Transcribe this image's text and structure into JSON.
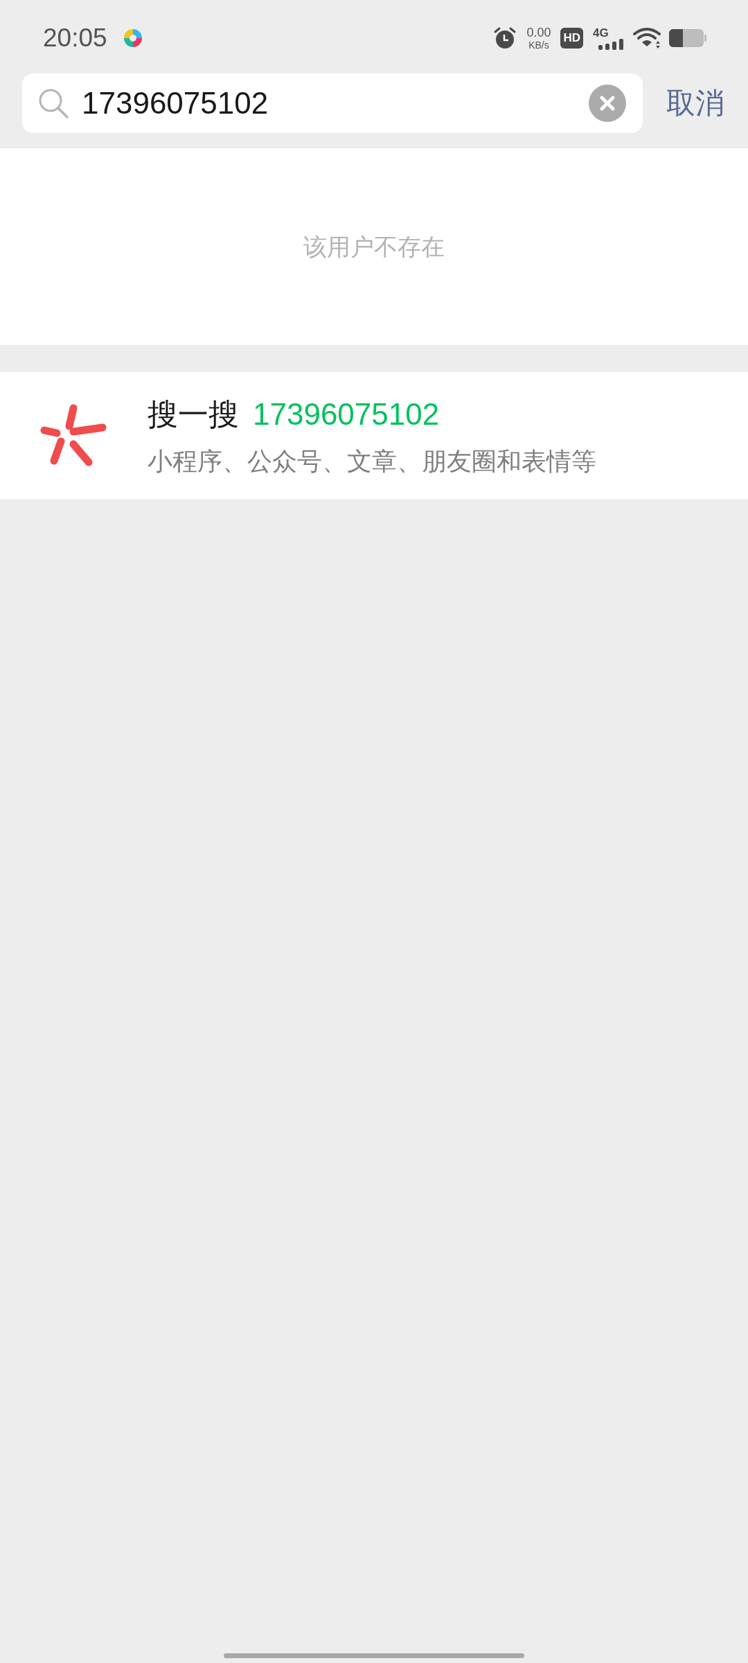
{
  "status_bar": {
    "time": "20:05",
    "net_speed_value": "0.00",
    "net_speed_unit": "KB/s",
    "hd_badge": "HD",
    "network_type": "4G"
  },
  "search": {
    "value": "17396075102",
    "cancel": "取消"
  },
  "user_result": {
    "message": "该用户不存在"
  },
  "search_suggestion": {
    "label": "搜一搜",
    "query": "17396075102",
    "description": "小程序、公众号、文章、朋友圈和表情等"
  }
}
